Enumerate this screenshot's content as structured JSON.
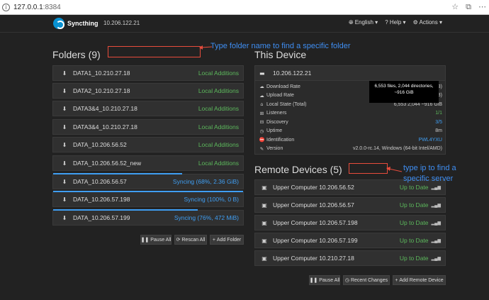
{
  "browser": {
    "url_host": "127.0.0.1",
    "url_port": ":8384",
    "icons": [
      "star-icon",
      "collections-icon",
      "browser-menu-icon"
    ]
  },
  "navbar": {
    "brand": "Syncthing",
    "device_name": "10.206.122.21",
    "language": "English",
    "help": "Help",
    "actions": "Actions"
  },
  "folders": {
    "title": "Folders (9)",
    "items": [
      {
        "label": "DATA1_10.210.27.18",
        "status": "Local Additions",
        "status_color": "#5cb85c",
        "progress": null
      },
      {
        "label": "DATA2_10.210.27.18",
        "status": "Local Additions",
        "status_color": "#5cb85c",
        "progress": null
      },
      {
        "label": "DATA3&4_10.210.27.18",
        "status": "Local Additions",
        "status_color": "#5cb85c",
        "progress": null
      },
      {
        "label": "DATA3&4_10.210.27.18",
        "status": "Local Additions",
        "status_color": "#5cb85c",
        "progress": null
      },
      {
        "label": "DATA_10.206.56.52",
        "status": "Local Additions",
        "status_color": "#5cb85c",
        "progress": null
      },
      {
        "label": "DATA_10.206.56.52_new",
        "status": "Local Additions",
        "status_color": "#5cb85c",
        "progress": null
      },
      {
        "label": "DATA_10.206.56.57",
        "status": "Syncing (68%, 2.36 GiB)",
        "status_color": "#3f9ef2",
        "progress": 0.68
      },
      {
        "label": "DATA_10.206.57.198",
        "status": "Syncing (100%, 0 B)",
        "status_color": "#3f9ef2",
        "progress": 1.0
      },
      {
        "label": "DATA_10.206.57.199",
        "status": "Syncing (76%, 472 MiB)",
        "status_color": "#3f9ef2",
        "progress": 0.76
      }
    ],
    "buttons": {
      "pause_all": "Pause All",
      "rescan_all": "Rescan All",
      "add_folder": "Add Folder"
    }
  },
  "this_device": {
    "title": "This Device",
    "name": "10.206.122.21",
    "stats": [
      {
        "label": "Download Rate",
        "value": "3)"
      },
      {
        "label": "Upload Rate",
        "value": "3)"
      },
      {
        "label": "Local State (Total)",
        "value": "6,553   2,044   ~916 GiB"
      },
      {
        "label": "Listeners",
        "value": "1/1",
        "color": "#5cb85c"
      },
      {
        "label": "Discovery",
        "value": "3/5",
        "color": "#3f9ef2"
      },
      {
        "label": "Uptime",
        "value": "8m"
      },
      {
        "label": "Identification",
        "value": "PWL4YXU",
        "color": "#3f9ef2"
      },
      {
        "label": "Version",
        "value": "v2.0.0-rc.14, Windows (64-bit Intel/AMD)"
      }
    ],
    "tooltip_line1": "6,553 files, 2,044 directories,",
    "tooltip_line2": "~916 GiB"
  },
  "remote_devices": {
    "title": "Remote Devices (5)",
    "items": [
      {
        "label": "Upper Computer 10.206.56.52",
        "status": "Up to Date"
      },
      {
        "label": "Upper Computer 10.206.56.57",
        "status": "Up to Date"
      },
      {
        "label": "Upper Computer 10.206.57.198",
        "status": "Up to Date"
      },
      {
        "label": "Upper Computer 10.206.57.199",
        "status": "Up to Date"
      },
      {
        "label": "Upper Computer 10.210.27.18",
        "status": "Up to Date"
      }
    ],
    "buttons": {
      "pause_all": "Pause All",
      "recent_changes": "Recent Changes",
      "add_remote": "Add Remote Device"
    }
  },
  "annotations": {
    "folder_hint": "Type folder name to find a specific folder",
    "ip_hint_line1": "type ip to find a",
    "ip_hint_line2": "specific server"
  }
}
